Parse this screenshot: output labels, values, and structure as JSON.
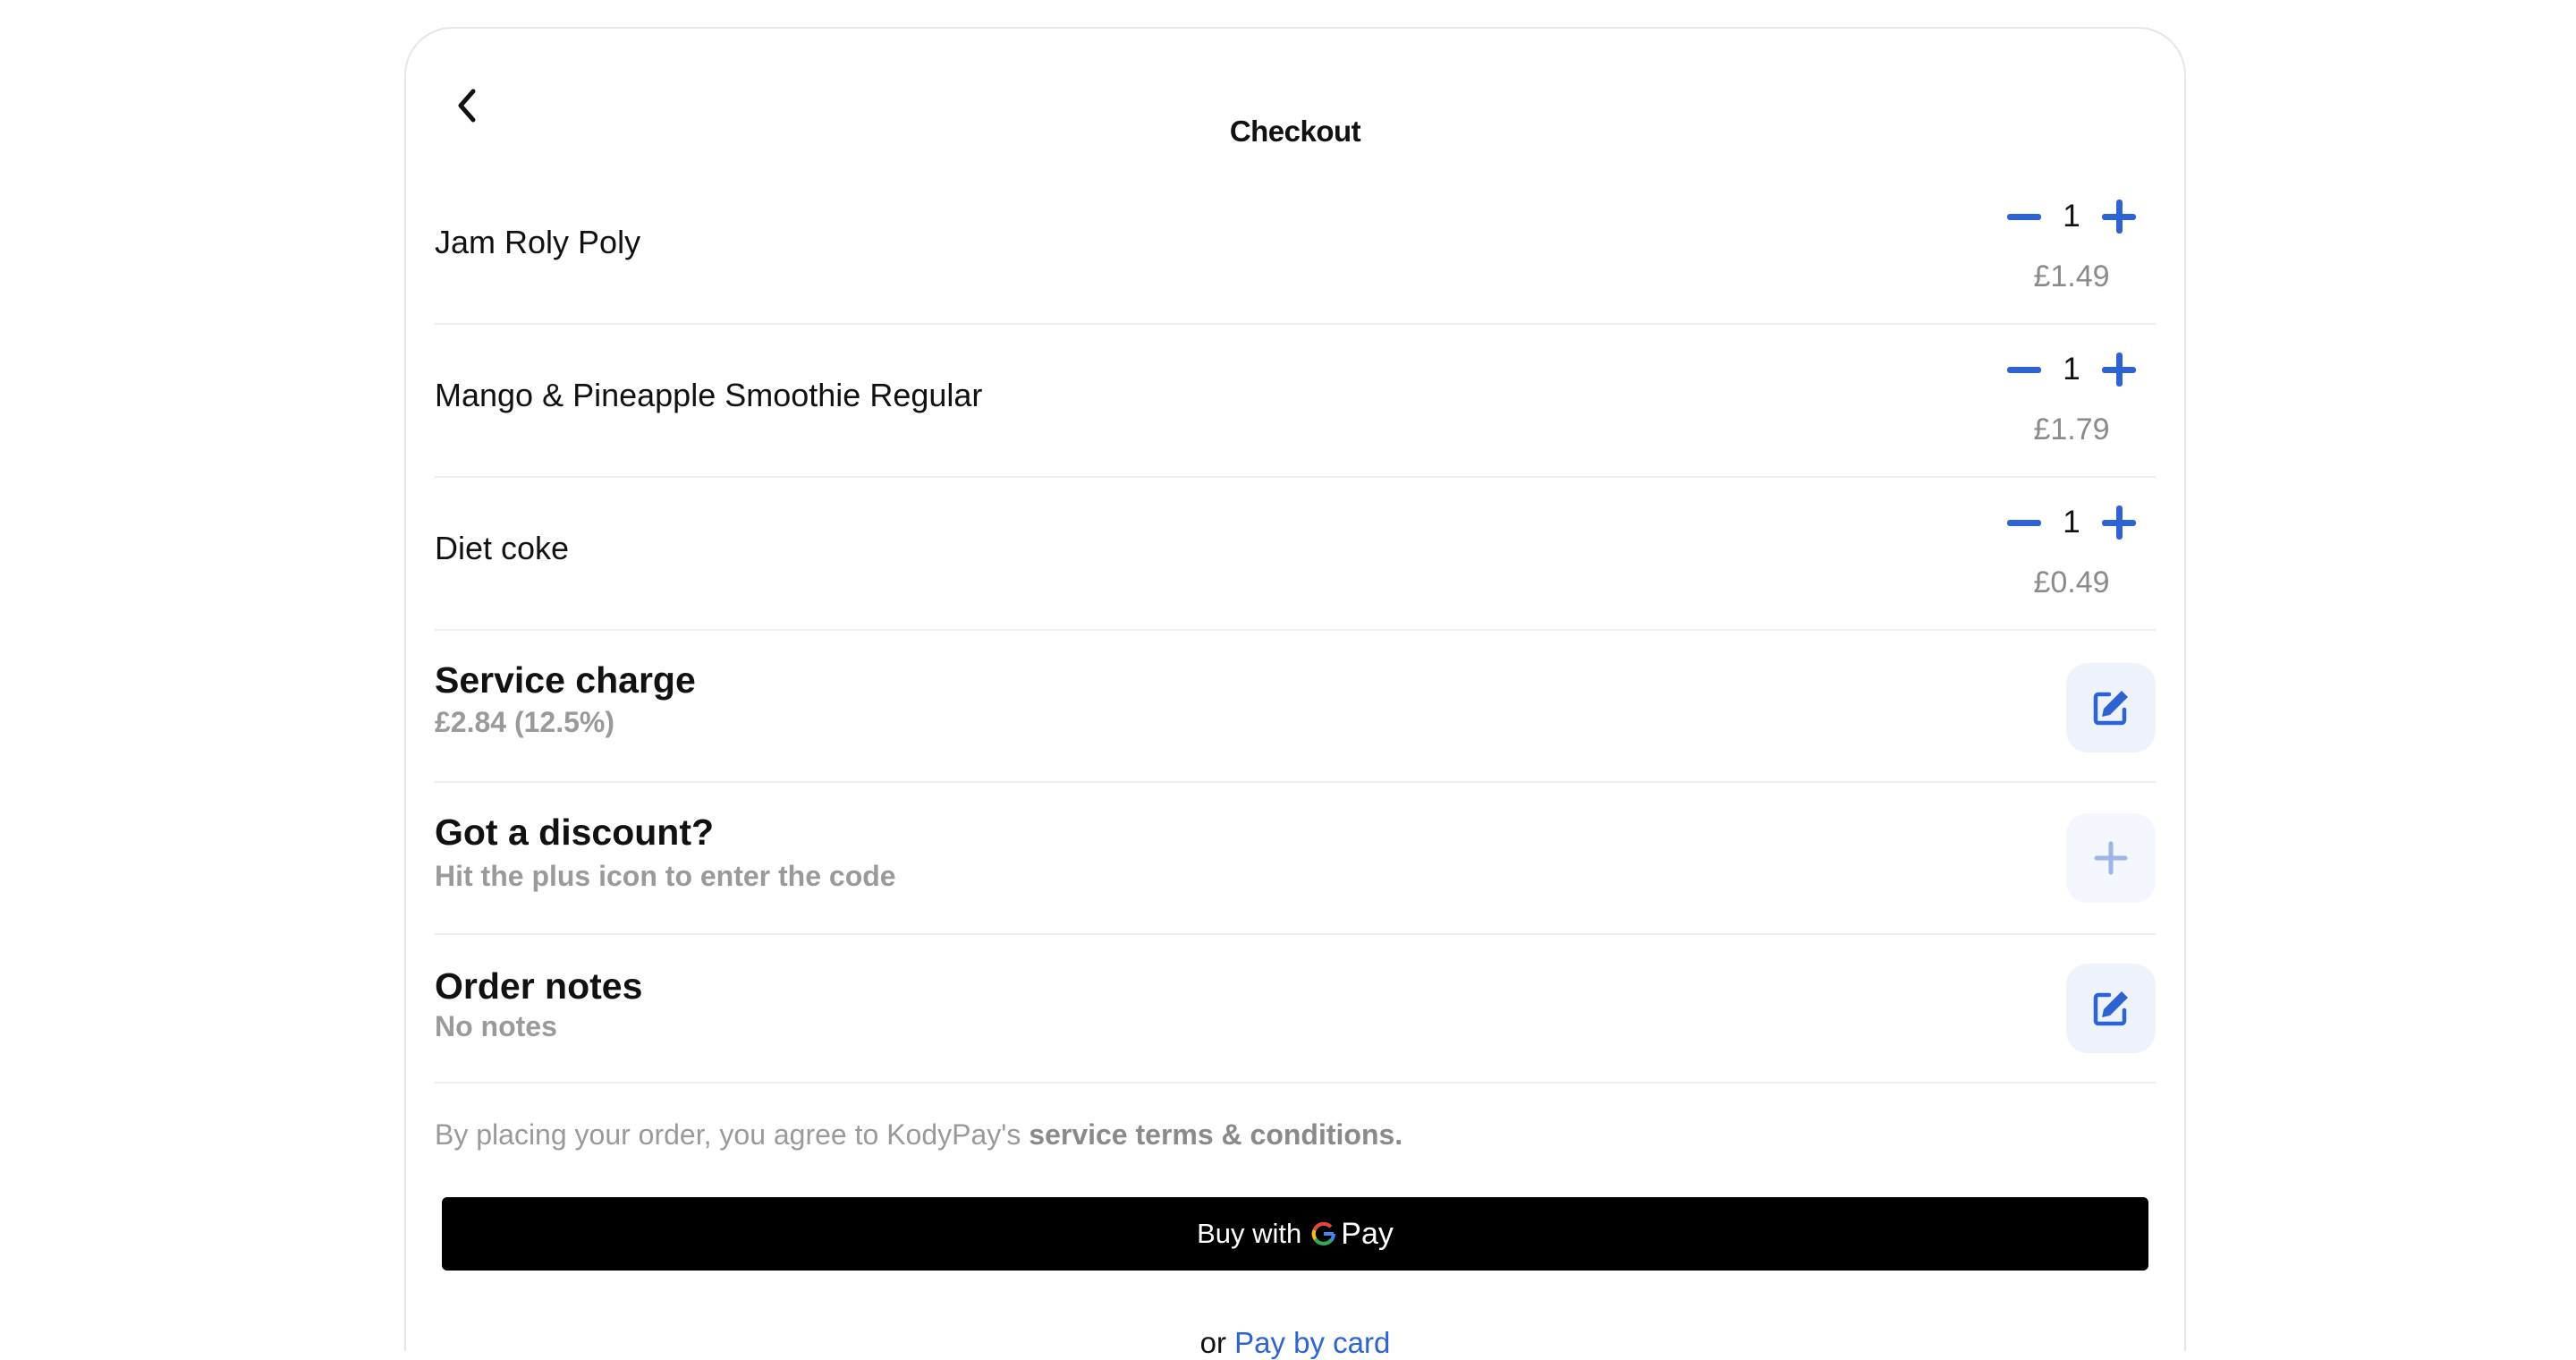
{
  "header": {
    "title": "Checkout"
  },
  "items": [
    {
      "name": "Jam Roly Poly",
      "quantity": "1",
      "price": "£1.49"
    },
    {
      "name": "Mango & Pineapple Smoothie Regular",
      "quantity": "1",
      "price": "£1.79"
    },
    {
      "name": "Diet coke",
      "quantity": "1",
      "price": "£0.49"
    }
  ],
  "service_charge": {
    "label": "Service charge",
    "value": "£2.84 (12.5%)"
  },
  "discount": {
    "label": "Got a discount?",
    "hint": "Hit the plus icon to enter the code"
  },
  "order_notes": {
    "label": "Order notes",
    "value": "No notes"
  },
  "terms": {
    "prefix": "By placing your order, you agree to KodyPay's",
    "link": "service terms & conditions."
  },
  "payment": {
    "buy_label": "Buy with",
    "gpay_g": "G",
    "gpay_label": "Pay",
    "alt_prefix": "or",
    "alt_link": "Pay by card"
  },
  "colors": {
    "accent": "#2d63d2",
    "muted": "#9a9a9a",
    "button_bg": "#000000",
    "action_bg": "#eef3fb"
  },
  "icons": {
    "back": "chevron-left-icon",
    "minus": "minus-icon",
    "plus": "plus-icon",
    "edit": "edit-icon",
    "google": "google-g-icon"
  }
}
